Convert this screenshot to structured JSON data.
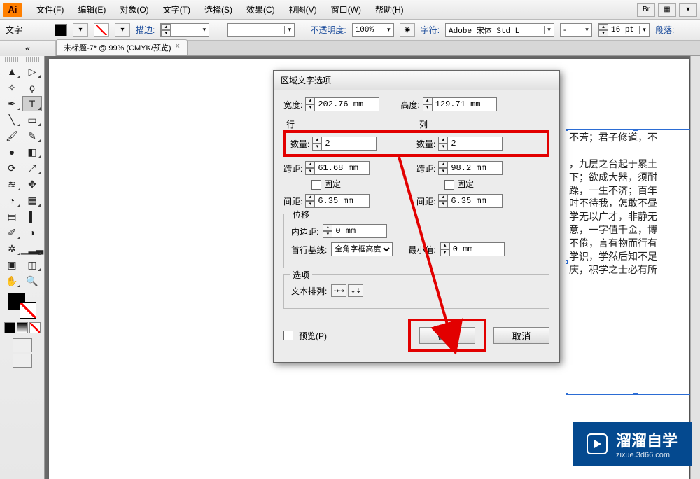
{
  "app": {
    "logo": "Ai"
  },
  "menu": {
    "items": [
      "文件(F)",
      "编辑(E)",
      "对象(O)",
      "文字(T)",
      "选择(S)",
      "效果(C)",
      "视图(V)",
      "窗口(W)",
      "帮助(H)"
    ]
  },
  "optbar": {
    "tool_label": "文字",
    "stroke_label": "描边:",
    "stroke_val": "",
    "opacity_label": "不透明度:",
    "opacity_val": "100%",
    "char_label": "字符:",
    "font": "Adobe 宋体 Std L",
    "style": "-",
    "size": "16 pt",
    "para_label": "段落:"
  },
  "doctab": {
    "title": "未标题-7* @ 99% (CMYK/预览)",
    "close": "×"
  },
  "toolbox": {
    "rows": [
      [
        "select-tool",
        "direct-select-tool"
      ],
      [
        "magic-wand-tool",
        "lasso-tool"
      ],
      [
        "pen-tool",
        "type-tool"
      ],
      [
        "line-tool",
        "rectangle-tool"
      ],
      [
        "paintbrush-tool",
        "pencil-tool"
      ],
      [
        "blob-brush-tool",
        "eraser-tool"
      ],
      [
        "rotate-tool",
        "scale-tool"
      ],
      [
        "width-tool",
        "free-transform-tool"
      ],
      [
        "shape-builder-tool",
        "perspective-grid-tool"
      ],
      [
        "mesh-tool",
        "gradient-tool"
      ],
      [
        "eyedropper-tool",
        "blend-tool"
      ],
      [
        "symbol-sprayer-tool",
        "column-graph-tool"
      ],
      [
        "artboard-tool",
        "slice-tool"
      ],
      [
        "hand-tool",
        "zoom-tool"
      ]
    ],
    "selected": "type-tool"
  },
  "textframe": {
    "body": "不芳；君子修道，不\n\n，九层之台起于累土\n下；欲成大器，须耐\n躁，一生不济；百年\n时不待我，怎敢不昼\n学无以广才，非静无\n意，一字值千金，博\n不倦，言有物而行有\n学识，学然后知不足\n庆，积学之士必有所"
  },
  "dialog": {
    "title": "区域文字选项",
    "width_lbl": "宽度:",
    "width_val": "202.76 mm",
    "height_lbl": "高度:",
    "height_val": "129.71 mm",
    "rows_legend": "行",
    "cols_legend": "列",
    "count_lbl": "数量:",
    "rows_count": "2",
    "cols_count": "2",
    "span_lbl": "跨距:",
    "rows_span": "61.68 mm",
    "cols_span": "98.2 mm",
    "fixed_lbl": "固定",
    "gutter_lbl": "间距:",
    "rows_gutter": "6.35 mm",
    "cols_gutter": "6.35 mm",
    "offset_legend": "位移",
    "inset_lbl": "内边距:",
    "inset_val": "0 mm",
    "baseline_lbl": "首行基线:",
    "baseline_val": "全角字框高度",
    "min_lbl": "最小值:",
    "min_val": "0 mm",
    "options_legend": "选项",
    "flow_lbl": "文本排列:",
    "preview_lbl": "预览(P)",
    "ok": "确定",
    "cancel": "取消"
  },
  "watermark": {
    "big": "溜溜自学",
    "small": "zixue.3d66.com"
  }
}
